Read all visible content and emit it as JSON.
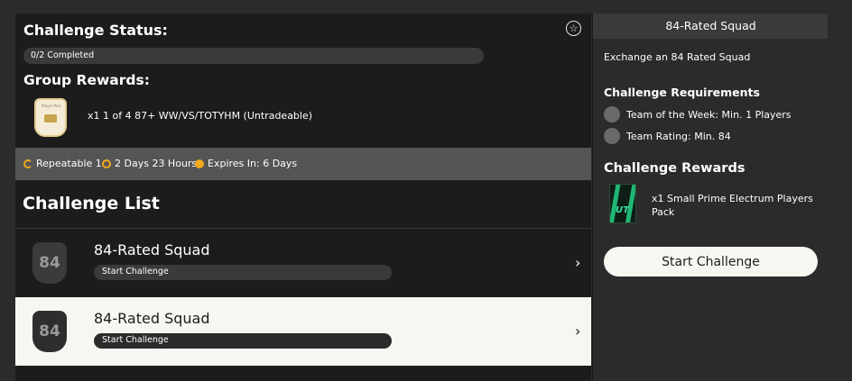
{
  "status": {
    "title": "Challenge Status:",
    "progress_text": "0/2 Completed",
    "progress_fraction": 0.0,
    "favorite_icon": "star-icon"
  },
  "group_rewards": {
    "title": "Group Rewards:",
    "reward_text": "x1 1 of 4 87+ WW/VS/TOTYHM (Untradeable)"
  },
  "meta": {
    "repeatable": "Repeatable 1",
    "duration": "2 Days 23 Hours",
    "expires": "Expires In: 6 Days",
    "accent": "#f2a91c"
  },
  "list": {
    "title": "Challenge List",
    "items": [
      {
        "rating": "84",
        "title": "84-Rated Squad",
        "cta": "Start Challenge"
      },
      {
        "rating": "84",
        "title": "84-Rated Squad",
        "cta": "Start Challenge"
      }
    ]
  },
  "detail": {
    "header": "84-Rated Squad",
    "description": "Exchange an 84 Rated Squad",
    "requirements_title": "Challenge Requirements",
    "requirements": [
      "Team of the Week: Min. 1 Players",
      "Team Rating: Min. 84"
    ],
    "rewards_title": "Challenge Rewards",
    "reward_pack_label": "UT",
    "reward_pack_text": "x1 Small Prime Electrum Players Pack",
    "start_button": "Start Challenge"
  }
}
